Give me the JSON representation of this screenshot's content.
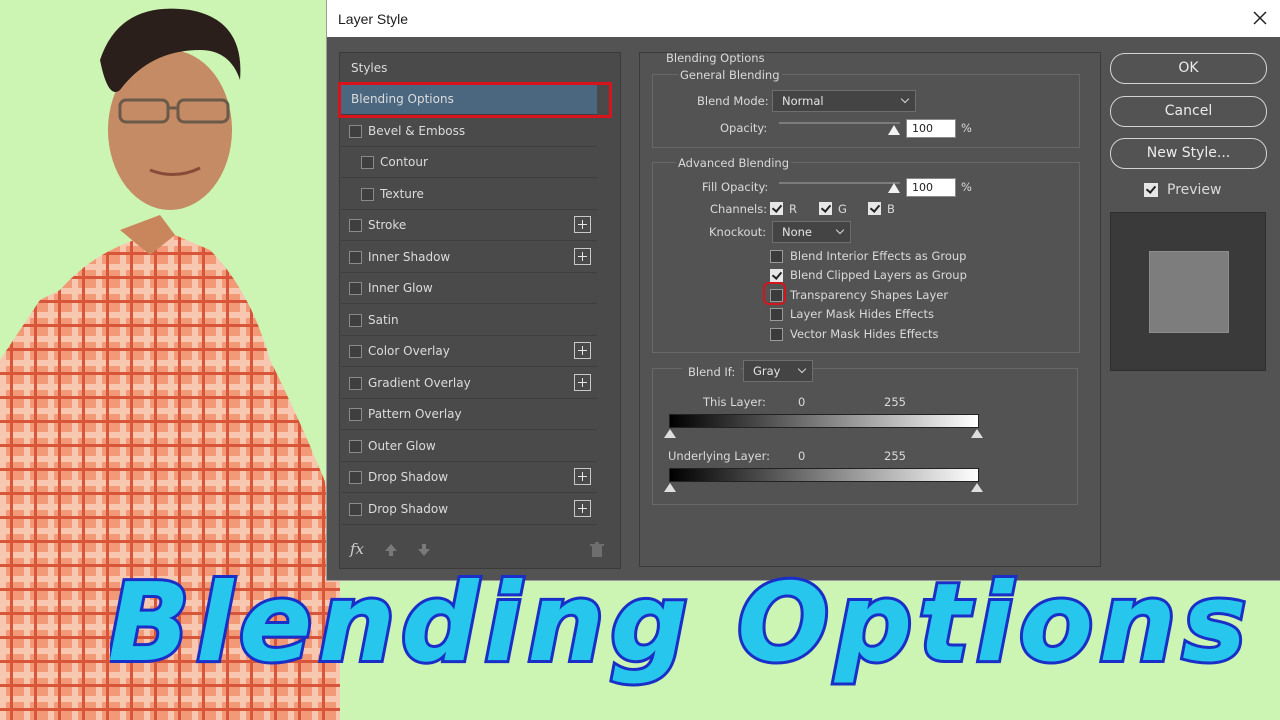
{
  "dialog": {
    "title": "Layer Style",
    "styles_header": "Styles",
    "style_items": [
      {
        "label": "Blending Options",
        "active": true
      },
      {
        "label": "Bevel & Emboss",
        "checkbox": true
      },
      {
        "label": "Contour",
        "checkbox": true,
        "indent": true
      },
      {
        "label": "Texture",
        "checkbox": true,
        "indent": true
      },
      {
        "label": "Stroke",
        "checkbox": true,
        "plus": true
      },
      {
        "label": "Inner Shadow",
        "checkbox": true,
        "plus": true
      },
      {
        "label": "Inner Glow",
        "checkbox": true
      },
      {
        "label": "Satin",
        "checkbox": true
      },
      {
        "label": "Color Overlay",
        "checkbox": true,
        "plus": true
      },
      {
        "label": "Gradient Overlay",
        "checkbox": true,
        "plus": true
      },
      {
        "label": "Pattern Overlay",
        "checkbox": true
      },
      {
        "label": "Outer Glow",
        "checkbox": true
      },
      {
        "label": "Drop Shadow",
        "checkbox": true,
        "plus": true
      },
      {
        "label": "Drop Shadow",
        "checkbox": true,
        "plus": true
      }
    ],
    "fx_label": "fx",
    "blending_options": {
      "section_title": "Blending Options",
      "general": {
        "title": "General Blending",
        "blend_mode_label": "Blend Mode:",
        "blend_mode_value": "Normal",
        "opacity_label": "Opacity:",
        "opacity_value": "100",
        "unit": "%"
      },
      "advanced": {
        "title": "Advanced Blending",
        "fill_opacity_label": "Fill Opacity:",
        "fill_opacity_value": "100",
        "unit": "%",
        "channels_label": "Channels:",
        "channels": [
          {
            "label": "R",
            "checked": true
          },
          {
            "label": "G",
            "checked": true
          },
          {
            "label": "B",
            "checked": true
          }
        ],
        "knockout_label": "Knockout:",
        "knockout_value": "None",
        "options": [
          {
            "label": "Blend Interior Effects as Group",
            "checked": false
          },
          {
            "label": "Blend Clipped Layers as Group",
            "checked": true
          },
          {
            "label": "Transparency Shapes Layer",
            "checked": false
          },
          {
            "label": "Layer Mask Hides Effects",
            "checked": false
          },
          {
            "label": "Vector Mask Hides Effects",
            "checked": false
          }
        ]
      },
      "blend_if": {
        "label": "Blend If:",
        "value": "Gray",
        "this_layer_label": "This Layer:",
        "this_layer_min": "0",
        "this_layer_max": "255",
        "underlying_label": "Underlying Layer:",
        "underlying_min": "0",
        "underlying_max": "255"
      }
    },
    "buttons": {
      "ok": "OK",
      "cancel": "Cancel",
      "new_style": "New Style...",
      "preview_label": "Preview",
      "preview_checked": true
    }
  },
  "overlay_title": "Blending Options",
  "colors": {
    "background": "#ccf5b4",
    "dialog": "#535353",
    "highlight_red": "#d7131c",
    "active_row": "#4a677f",
    "title_text": "#27c6ec"
  }
}
